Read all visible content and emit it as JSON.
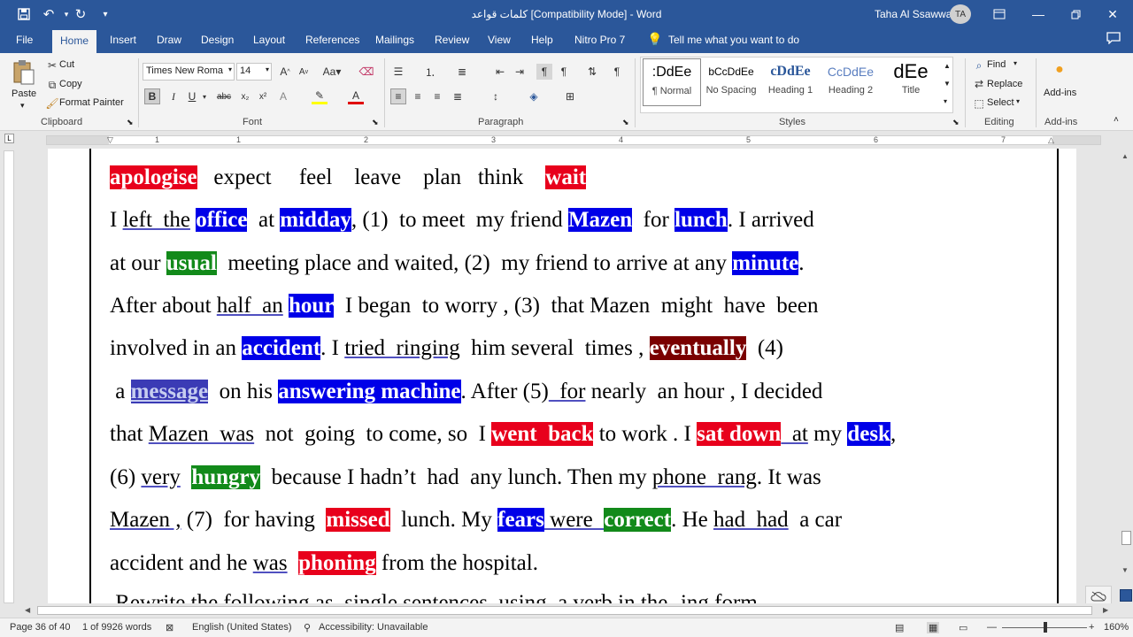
{
  "titlebar": {
    "document_title": "كلمات قواعد [Compatibility Mode]  -  Word",
    "user_name": "Taha Al Ssawwa",
    "user_initials": "TA",
    "qat_icons": [
      "save-icon",
      "undo-icon",
      "redo-icon",
      "customize-icon"
    ],
    "window_buttons": [
      "ribbon-display-icon",
      "minimize-icon",
      "restore-icon",
      "close-icon"
    ]
  },
  "tabs": [
    "File",
    "Home",
    "Insert",
    "Draw",
    "Design",
    "Layout",
    "References",
    "Mailings",
    "Review",
    "View",
    "Help",
    "Nitro Pro 7"
  ],
  "tell_me": "Tell me what you want to do",
  "clipboard": {
    "paste": "Paste",
    "cut": "Cut",
    "copy": "Copy",
    "format_painter": "Format Painter",
    "label": "Clipboard"
  },
  "font": {
    "name": "Times New Roma",
    "size": "14",
    "label": "Font"
  },
  "paragraph": {
    "label": "Paragraph"
  },
  "styles": {
    "label": "Styles",
    "items": [
      {
        "preview": ":DdEe",
        "name": "¶ Normal"
      },
      {
        "preview": "bCcDdEe",
        "name": "No Spacing"
      },
      {
        "preview": "cDdEe",
        "name": "Heading 1"
      },
      {
        "preview": "CcDdEe",
        "name": "Heading 2"
      },
      {
        "preview": "dEe",
        "name": "Title"
      }
    ]
  },
  "editing": {
    "find": "Find",
    "replace": "Replace",
    "select": "Select",
    "label": "Editing"
  },
  "addins": {
    "button": "Add-ins",
    "label": "Add-ins"
  },
  "ruler_numbers": [
    "1",
    "1",
    "2",
    "3",
    "4",
    "5",
    "6",
    "7"
  ],
  "document": {
    "line1": {
      "w1": "apologise",
      "w2": "expect",
      "w3": "feel",
      "w4": "leave",
      "w5": "plan",
      "w6": "think",
      "w7": "wait"
    },
    "line2": {
      "a": "I ",
      "b": "left  the",
      "c": " ",
      "d": "office",
      "e": "  at ",
      "f": "midday",
      "g": ", (1)  to meet  my friend ",
      "h": "Mazen",
      "i": "  for ",
      "j": "lunch",
      "k": ". I arrived"
    },
    "line3": {
      "a": "at our ",
      "b": "usual",
      "c": "  meeting place and waited, (2)  my friend to arrive at any ",
      "d": "minute",
      "e": "."
    },
    "line4": {
      "a": "After about ",
      "b": "half  an",
      "c": " ",
      "d": "hour",
      "e": "  I began  to worry , (3)  that Mazen  might  have  been"
    },
    "line5": {
      "a": "involved in an ",
      "b": "accident",
      "c": ". I ",
      "d": "tried  ringing",
      "e": "  him several  times , ",
      "f": "eventually",
      "g": "  (4)"
    },
    "line6": {
      "a": " a ",
      "b": "message",
      "c": "  on his ",
      "d": "answering machine",
      "e": ". After (5)",
      "f": "  for",
      "g": " nearly  an hour , I decided"
    },
    "line7": {
      "a": "that ",
      "b": "Mazen  was",
      "c": "  not  going  to come, so  I ",
      "d": "went  back",
      "e": " to work . I ",
      "f": "sat down",
      "g": "  at",
      "h": " my ",
      "i": "desk",
      "j": ","
    },
    "line8": {
      "a": "(6) ",
      "b": "very",
      "c": "  ",
      "d": "hungry",
      "e": "  because I hadn’t  had  any lunch. Then my ",
      "f": "phone  rang",
      "g": ". It was"
    },
    "line9": {
      "a": "Mazen ,",
      "b": " (7)  for having  ",
      "c": "missed",
      "d": "  lunch. My ",
      "e": "fears",
      "f": " were  ",
      "g": "correct",
      "h": ". He ",
      "i": "had  had",
      "j": "  a car"
    },
    "line10": {
      "a": "accident and he ",
      "b": "was",
      "c": "  ",
      "d": "phoning",
      "e": " from the hospital."
    },
    "line11": " Rewrite the following as  single sentences, using  a verb in the -ing form"
  },
  "status": {
    "page": "Page 36 of 40",
    "words": "1 of 9926 words",
    "language": "English (United States)",
    "accessibility": "Accessibility: Unavailable",
    "zoom": "160%"
  },
  "colors": {
    "accent": "#2b579a",
    "red": "#e8001c",
    "blue": "#0000e8",
    "green": "#128a1a",
    "dark_red": "#7a0000"
  }
}
